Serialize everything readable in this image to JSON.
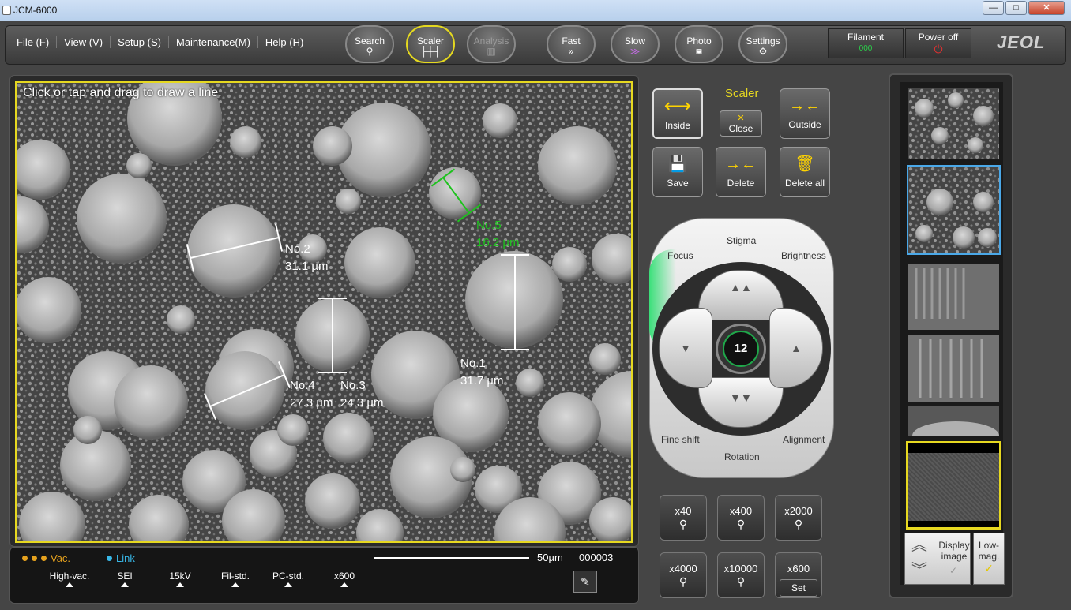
{
  "window": {
    "title": "JCM-6000",
    "minimize": "—",
    "maximize": "□",
    "close": "✕"
  },
  "menu": [
    "File (F)",
    "View (V)",
    "Setup (S)",
    "Maintenance(M)",
    "Help (H)"
  ],
  "toolbar": [
    {
      "label": "Search",
      "icon": "magnifier-icon",
      "glyph": "⚲",
      "state": "normal"
    },
    {
      "label": "Scaler",
      "icon": "scaler-icon",
      "glyph": "├┼┤",
      "state": "active"
    },
    {
      "label": "Analysis",
      "icon": "chart-icon",
      "glyph": "▥",
      "state": "disabled"
    },
    {
      "label": "Fast",
      "icon": "double-chevron-icon",
      "glyph": "»",
      "state": "normal"
    },
    {
      "label": "Slow",
      "icon": "slow-icon",
      "glyph": "≫",
      "state": "normal"
    },
    {
      "label": "Photo",
      "icon": "camera-icon",
      "glyph": "◙",
      "state": "normal"
    },
    {
      "label": "Settings",
      "icon": "settings-icon",
      "glyph": "⚙",
      "state": "normal"
    }
  ],
  "filament": {
    "label": "Filament",
    "indicator": "000",
    "indicator_color": "#2bd04a"
  },
  "power": {
    "label": "Power off",
    "icon": "⏻",
    "color": "#e03030"
  },
  "brand": "JEOL",
  "image": {
    "hint": "Click or tap and drag to draw a line.",
    "measurements": [
      {
        "id": "No.1",
        "value": "31.7 µm",
        "color": "#ffffff"
      },
      {
        "id": "No.2",
        "value": "31.1 µm",
        "color": "#ffffff"
      },
      {
        "id": "No.3",
        "value": "24.3 µm",
        "color": "#ffffff"
      },
      {
        "id": "No.4",
        "value": "27.3 µm",
        "color": "#ffffff"
      },
      {
        "id": "No.5",
        "value": "16.2 µm",
        "color": "#1ec21e"
      }
    ]
  },
  "status": {
    "vac": "Vac.",
    "link": "Link",
    "scalebar": "50µm",
    "counter": "000003",
    "params": [
      "High-vac.",
      "SEI",
      "15kV",
      "Fil-std.",
      "PC-std.",
      "x600"
    ],
    "note_icon": "✎"
  },
  "scaler": {
    "title": "Scaler",
    "buttons": [
      {
        "label": "Inside",
        "glyph": "⟷",
        "selected": true
      },
      {
        "label": "Close",
        "glyph": "✕",
        "selected": false
      },
      {
        "label": "Outside",
        "glyph": "→←",
        "selected": false
      },
      {
        "label": "Save",
        "glyph": "💾",
        "selected": false
      },
      {
        "label": "Delete",
        "glyph": "→←",
        "selected": false
      },
      {
        "label": "Delete all",
        "glyph": "🗑",
        "selected": false
      }
    ]
  },
  "dial": {
    "labels": {
      "focus": "Focus",
      "stigma": "Stigma",
      "brightness": "Brightness",
      "fine_shift": "Fine shift",
      "rotation": "Rotation",
      "alignment": "Alignment"
    },
    "value": "12",
    "arrows": {
      "up": "▲▲",
      "down": "▼▼",
      "left": "▼",
      "right": "▲"
    }
  },
  "magnification": [
    {
      "label": "x40"
    },
    {
      "label": "x400"
    },
    {
      "label": "x2000"
    },
    {
      "label": "x4000"
    },
    {
      "label": "x10000"
    },
    {
      "label": "x600",
      "sub": "Set"
    }
  ],
  "thumbs": {
    "display_label": "Display image",
    "low_label": "Low-mag.",
    "check": "✓"
  }
}
